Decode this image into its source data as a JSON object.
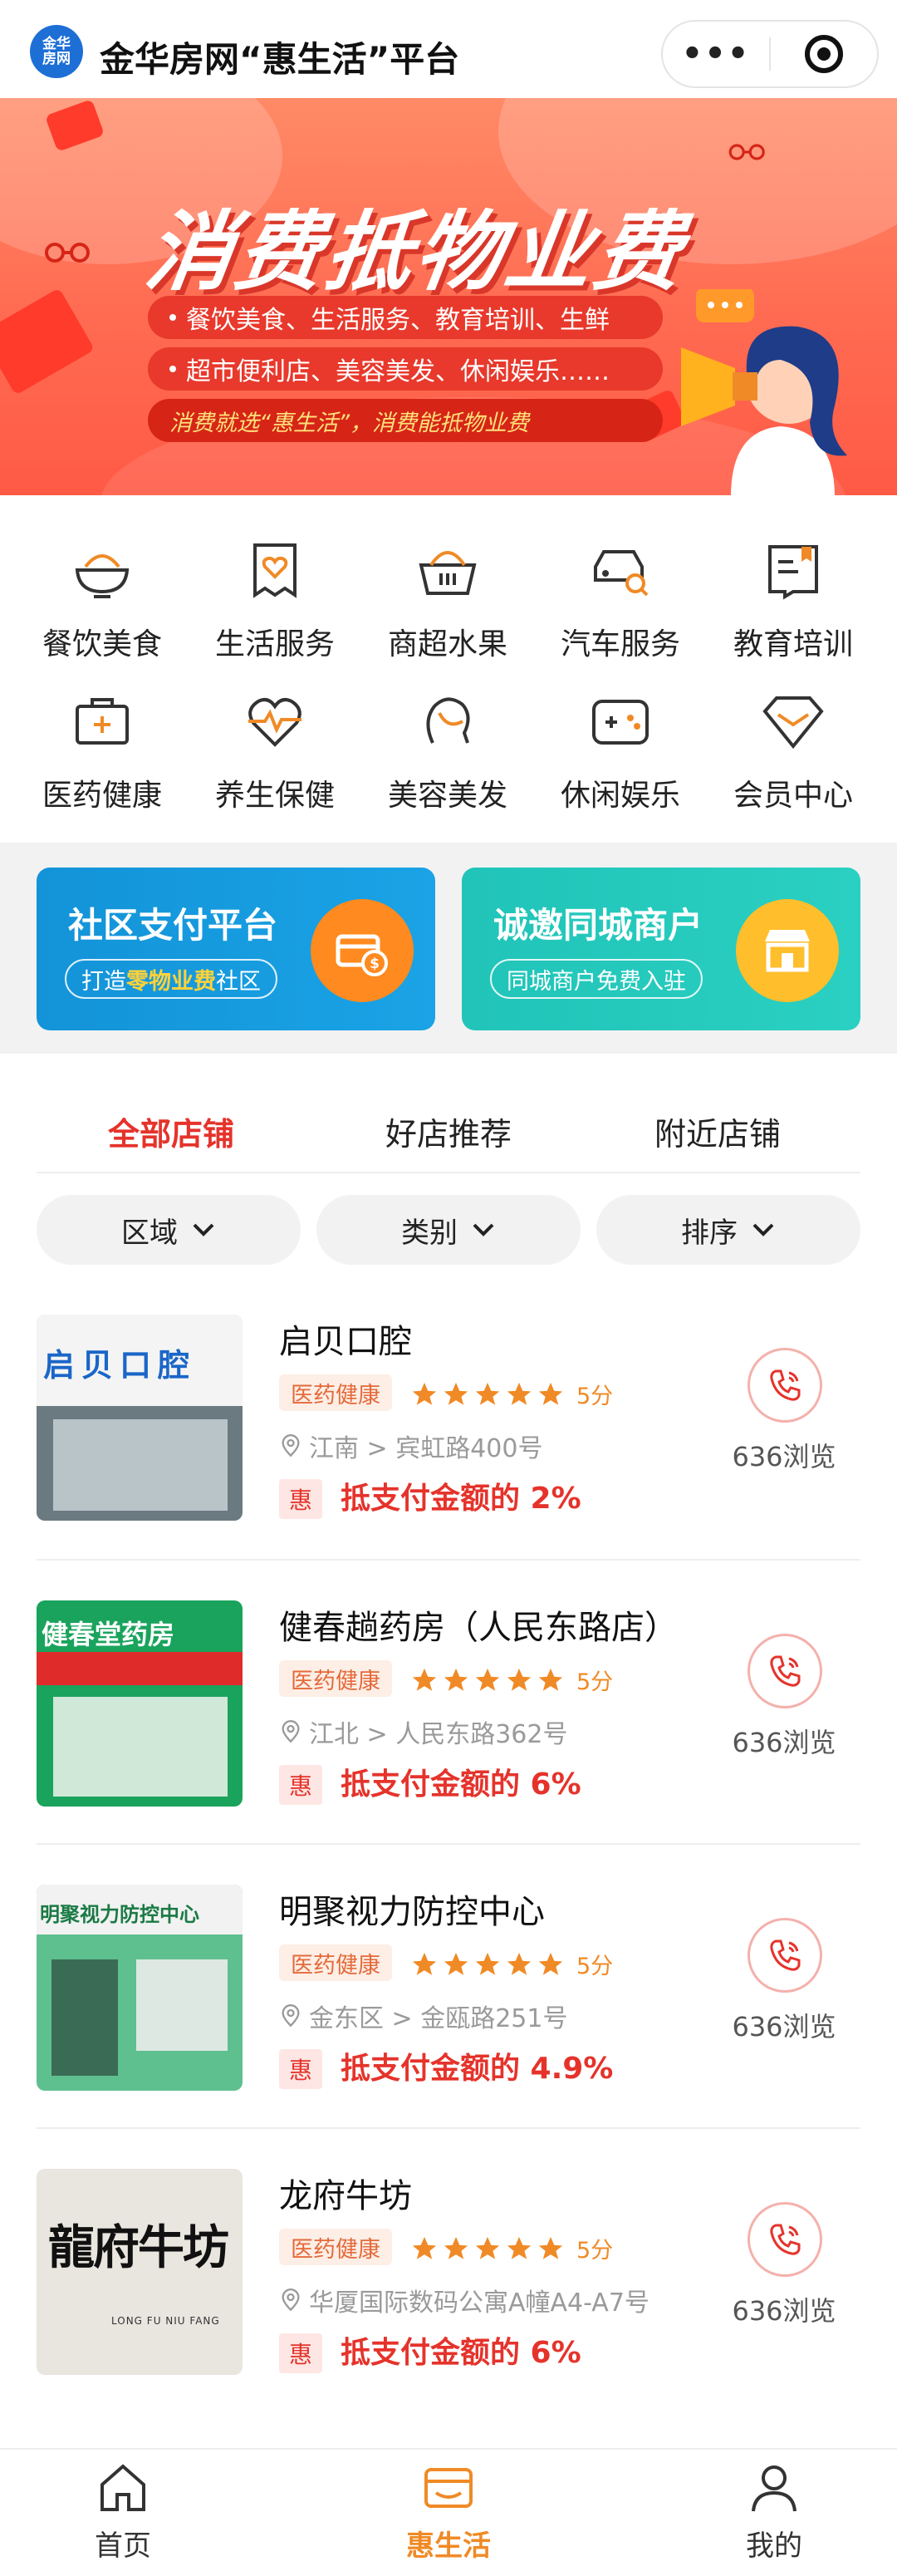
{
  "header": {
    "logo_line1": "金华",
    "logo_line2": "房网",
    "title": "金华房网“惠生活”平台",
    "more_glyph": "•••"
  },
  "banner": {
    "headline": "消费抵物业费",
    "line1": "餐饮美食、生活服务、教育培训、生鲜",
    "line2": "超市便利店、美容美发、休闲娱乐……",
    "line3": "消费就选“惠生活”，消费能抵物业费"
  },
  "categories": [
    {
      "label": "餐饮美食",
      "icon": "food-bowl-icon"
    },
    {
      "label": "生活服务",
      "icon": "heart-receipt-icon"
    },
    {
      "label": "商超水果",
      "icon": "basket-icon"
    },
    {
      "label": "汽车服务",
      "icon": "car-search-icon"
    },
    {
      "label": "教育培训",
      "icon": "book-icon"
    },
    {
      "label": "医药健康",
      "icon": "medical-kit-icon"
    },
    {
      "label": "养生保健",
      "icon": "heartbeat-icon"
    },
    {
      "label": "美容美发",
      "icon": "face-icon"
    },
    {
      "label": "休闲娱乐",
      "icon": "gamepad-icon"
    },
    {
      "label": "会员中心",
      "icon": "diamond-icon"
    }
  ],
  "promos": {
    "community": {
      "title": "社区支付平台",
      "sub_pre": "打造",
      "sub_highlight": "零物业费",
      "sub_post": "社区"
    },
    "merchant": {
      "title": "诚邀同城商户",
      "sub": "同城商户免费入驻"
    }
  },
  "tabs": [
    {
      "label": "全部店铺",
      "active": true
    },
    {
      "label": "好店推荐",
      "active": false
    },
    {
      "label": "附近店铺",
      "active": false
    }
  ],
  "filters": [
    {
      "label": "区域"
    },
    {
      "label": "类别"
    },
    {
      "label": "排序"
    }
  ],
  "stores": [
    {
      "name": "启贝口腔",
      "tag": "医药健康",
      "rating": 5,
      "score": "5分",
      "address": "江南 > 宾虹路400号",
      "hui": "惠",
      "rebate": "抵支付金额的 2%",
      "views": "636浏览",
      "sign": "启贝口腔"
    },
    {
      "name": "健春趟药房（人民东路店）",
      "tag": "医药健康",
      "rating": 5,
      "score": "5分",
      "address": "江北 > 人民东路362号",
      "hui": "惠",
      "rebate": "抵支付金额的 6%",
      "views": "636浏览",
      "sign": "健春堂药房"
    },
    {
      "name": "明聚视力防控中心",
      "tag": "医药健康",
      "rating": 5,
      "score": "5分",
      "address": "金东区 > 金瓯路251号",
      "hui": "惠",
      "rebate": "抵支付金额的 4.9%",
      "views": "636浏览",
      "sign": "明聚视力防控中心"
    },
    {
      "name": "龙府牛坊",
      "tag": "医药健康",
      "rating": 5,
      "score": "5分",
      "address": "华厦国际数码公寓A幢A4-A7号",
      "hui": "惠",
      "rebate": "抵支付金额的 6%",
      "views": "636浏览",
      "sign": "龍府牛坊",
      "sign_sub": "LONG FU NIU FANG"
    }
  ],
  "bottom_nav": [
    {
      "label": "首页",
      "icon": "home-icon",
      "active": false
    },
    {
      "label": "惠生活",
      "icon": "wallet-icon",
      "active": true
    },
    {
      "label": "我的",
      "icon": "user-icon",
      "active": false
    }
  ],
  "colors": {
    "accent_red": "#e5332b",
    "accent_orange": "#f08a26",
    "promo_blue": "#1393d8",
    "promo_teal": "#21c4b8"
  }
}
